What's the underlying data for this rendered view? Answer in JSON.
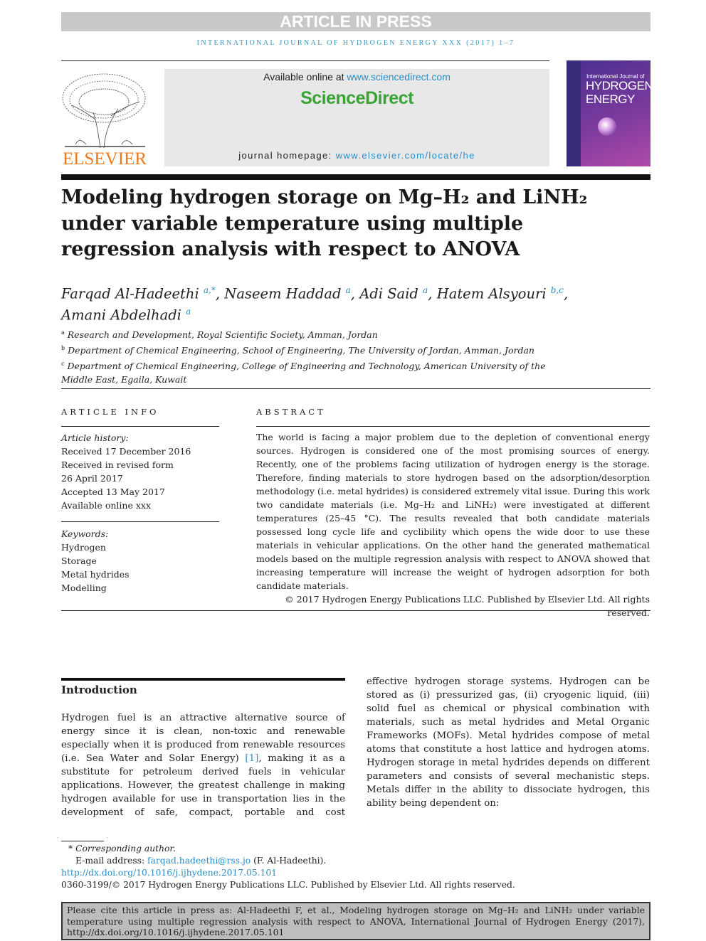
{
  "banner": "ARTICLE IN PRESS",
  "journal_header": "INTERNATIONAL JOURNAL OF HYDROGEN ENERGY XXX (2017) 1–7",
  "publisher_logo_text": "ELSEVIER",
  "masthead": {
    "available_prefix": "Available online at ",
    "available_link": "www.sciencedirect.com",
    "brand": "ScienceDirect",
    "homepage_prefix": "journal homepage: ",
    "homepage_link": "www.elsevier.com/locate/he"
  },
  "cover": {
    "line1": "International Journal of",
    "line2": "HYDROGEN",
    "line3": "ENERGY"
  },
  "title": "Modeling hydrogen storage on Mg–H₂ and LiNH₂ under variable temperature using multiple regression analysis with respect to ANOVA",
  "authors": [
    {
      "name": "Farqad Al-Hadeethi",
      "sup": "a,*"
    },
    {
      "name": "Naseem Haddad",
      "sup": "a"
    },
    {
      "name": "Adi Said",
      "sup": "a"
    },
    {
      "name": "Hatem Alsyouri",
      "sup": "b,c"
    },
    {
      "name": "Amani Abdelhadi",
      "sup": "a"
    }
  ],
  "affiliations": [
    {
      "mark": "a",
      "text": "Research and Development, Royal Scientific Society, Amman, Jordan"
    },
    {
      "mark": "b",
      "text": "Department of Chemical Engineering, School of Engineering, The University of Jordan, Amman, Jordan"
    },
    {
      "mark": "c",
      "text": "Department of Chemical Engineering, College of Engineering and Technology, American University of the Middle East, Egaila, Kuwait"
    }
  ],
  "article_info": {
    "heading": "ARTICLE INFO",
    "history_label": "Article history:",
    "history": [
      "Received 17 December 2016",
      "Received in revised form",
      "26 April 2017",
      "Accepted 13 May 2017",
      "Available online xxx"
    ],
    "keywords_label": "Keywords:",
    "keywords": [
      "Hydrogen",
      "Storage",
      "Metal hydrides",
      "Modelling"
    ]
  },
  "abstract": {
    "heading": "ABSTRACT",
    "text": "The world is facing a major problem due to the depletion of conventional energy sources. Hydrogen is considered one of the most promising sources of energy. Recently, one of the problems facing utilization of hydrogen energy is the storage. Therefore, finding materials to store hydrogen based on the adsorption/desorption methodology (i.e. metal hydrides) is considered extremely vital issue. During this work two candidate materials (i.e. Mg–H₂ and LiNH₂) were investigated at different temperatures (25–45 °C). The results revealed that both candidate materials possessed long cycle life and cyclibility which opens the wide door to use these materials in vehicular applications. On the other hand the generated mathematical models based on the multiple regression analysis with respect to ANOVA showed that increasing temperature will increase the weight of hydrogen adsorption for both candidate materials.",
    "copyright": "© 2017 Hydrogen Energy Publications LLC. Published by Elsevier Ltd. All rights reserved."
  },
  "introduction": {
    "heading": "Introduction",
    "left_p1": "Hydrogen fuel is an attractive alternative source of energy since it is clean, non-toxic and renewable especially when it is produced from renewable resources (i.e. Sea Water and Solar Energy) ",
    "ref": "[1]",
    "left_p2": ", making it as a substitute for petroleum derived fuels in vehicular applications. However, the greatest challenge in making hydrogen available for use in transportation lies in the development of safe, compact, portable and cost",
    "right": "effective hydrogen storage systems. Hydrogen can be stored as (i) pressurized gas, (ii) cryogenic liquid, (iii) solid fuel as chemical or physical combination with materials, such as metal hydrides and Metal Organic Frameworks (MOFs). Metal hydrides compose of metal atoms that constitute a host lattice and hydrogen atoms. Hydrogen storage in metal hydrides depends on different parameters and consists of several mechanistic steps. Metals differ in the ability to dissociate hydrogen, this ability being dependent on:"
  },
  "footnotes": {
    "corresponding": "Corresponding author.",
    "email_label": "E-mail address: ",
    "email": "farqad.hadeethi@rss.jo",
    "email_suffix": " (F. Al-Hadeethi).",
    "doi": "http://dx.doi.org/10.1016/j.ijhydene.2017.05.101",
    "issn_line": "0360-3199/© 2017 Hydrogen Energy Publications LLC. Published by Elsevier Ltd. All rights reserved."
  },
  "citation": "Please cite this article in press as: Al-Hadeethi F, et al., Modeling hydrogen storage on Mg–H₂ and LiNH₂ under variable temperature using multiple regression analysis with respect to ANOVA, International Journal of Hydrogen Energy (2017), http://dx.doi.org/10.1016/j.ijhydene.2017.05.101",
  "colors": {
    "link": "#2a8ec8",
    "brand_green": "#3aa335",
    "elsevier_orange": "#f07a1a",
    "banner_gray": "#c8c8c8"
  }
}
